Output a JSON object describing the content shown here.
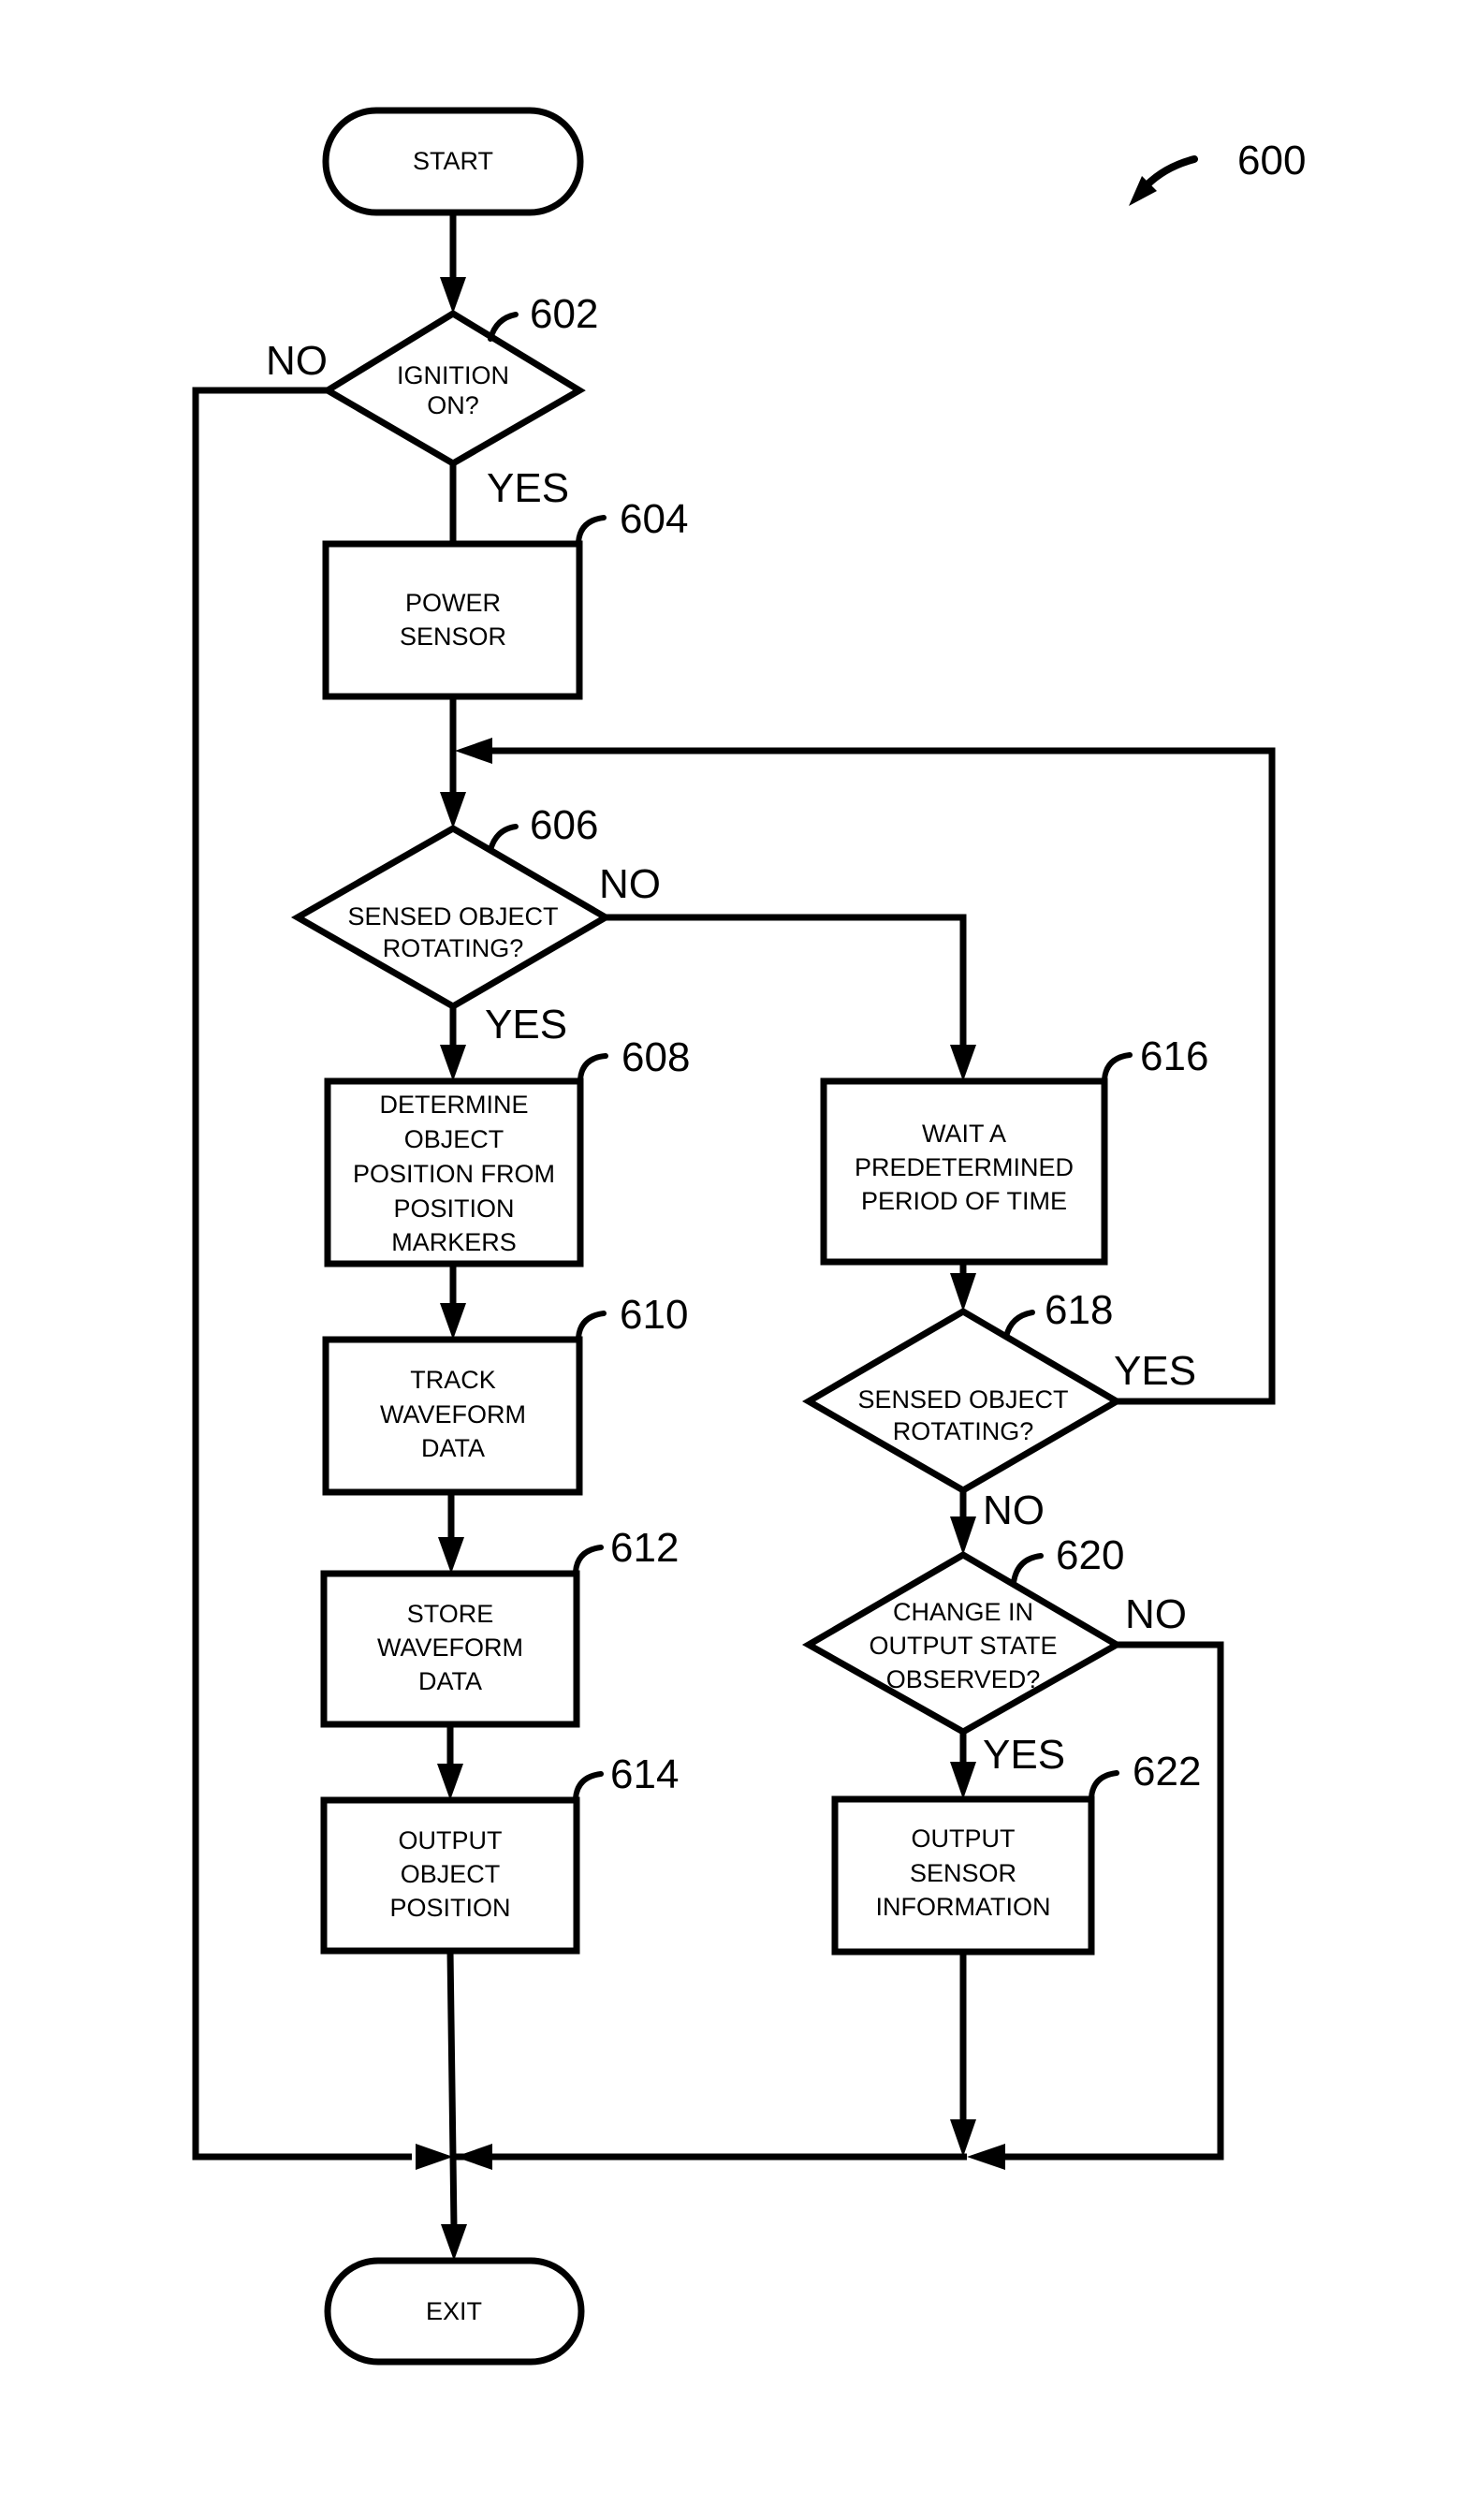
{
  "figure": {
    "reference": "600"
  },
  "nodes": {
    "start": {
      "type": "terminal",
      "text": [
        "START"
      ]
    },
    "n602": {
      "type": "decision",
      "ref": "602",
      "text": [
        "IGNITION",
        "ON?"
      ]
    },
    "n604": {
      "type": "process",
      "ref": "604",
      "text": [
        "POWER",
        "SENSOR"
      ]
    },
    "n606": {
      "type": "decision",
      "ref": "606",
      "text": [
        "SENSED OBJECT",
        "ROTATING?"
      ]
    },
    "n608": {
      "type": "process",
      "ref": "608",
      "text": [
        "DETERMINE",
        "OBJECT",
        "POSITION FROM",
        "POSITION",
        "MARKERS"
      ]
    },
    "n610": {
      "type": "process",
      "ref": "610",
      "text": [
        "TRACK",
        "WAVEFORM",
        "DATA"
      ]
    },
    "n612": {
      "type": "process",
      "ref": "612",
      "text": [
        "STORE",
        "WAVEFORM",
        "DATA"
      ]
    },
    "n614": {
      "type": "process",
      "ref": "614",
      "text": [
        "OUTPUT",
        "OBJECT",
        "POSITION"
      ]
    },
    "n616": {
      "type": "process",
      "ref": "616",
      "text": [
        "WAIT A",
        "PREDETERMINED",
        "PERIOD OF TIME"
      ]
    },
    "n618": {
      "type": "decision",
      "ref": "618",
      "text": [
        "SENSED OBJECT",
        "ROTATING?"
      ]
    },
    "n620": {
      "type": "decision",
      "ref": "620",
      "text": [
        "CHANGE IN",
        "OUTPUT STATE",
        "OBSERVED?"
      ]
    },
    "n622": {
      "type": "process",
      "ref": "622",
      "text": [
        "OUTPUT",
        "SENSOR",
        "INFORMATION"
      ]
    },
    "exit": {
      "type": "terminal",
      "text": [
        "EXIT"
      ]
    }
  },
  "edges": [
    {
      "from": "start",
      "to": "n602",
      "label": ""
    },
    {
      "from": "n602",
      "to": "exit",
      "label": "NO"
    },
    {
      "from": "n602",
      "to": "n604",
      "label": "YES"
    },
    {
      "from": "n604",
      "to": "n606",
      "label": ""
    },
    {
      "from": "n606",
      "to": "n608",
      "label": "YES"
    },
    {
      "from": "n606",
      "to": "n616",
      "label": "NO"
    },
    {
      "from": "n608",
      "to": "n610",
      "label": ""
    },
    {
      "from": "n610",
      "to": "n612",
      "label": ""
    },
    {
      "from": "n612",
      "to": "n614",
      "label": ""
    },
    {
      "from": "n614",
      "to": "exit",
      "label": ""
    },
    {
      "from": "n616",
      "to": "n618",
      "label": ""
    },
    {
      "from": "n618",
      "to": "n606",
      "label": "YES"
    },
    {
      "from": "n618",
      "to": "n620",
      "label": "NO"
    },
    {
      "from": "n620",
      "to": "n622",
      "label": "YES"
    },
    {
      "from": "n620",
      "to": "exit",
      "label": "NO"
    },
    {
      "from": "n622",
      "to": "exit",
      "label": ""
    }
  ],
  "branch_labels": {
    "n602_no": "NO",
    "n602_yes": "YES",
    "n606_no": "NO",
    "n606_yes": "YES",
    "n618_yes": "YES",
    "n618_no": "NO",
    "n620_no": "NO",
    "n620_yes": "YES"
  }
}
